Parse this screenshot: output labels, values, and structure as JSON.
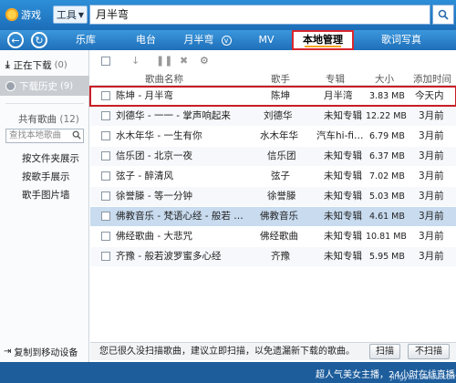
{
  "topbar": {
    "game_label": "游戏",
    "tools_label": "工具",
    "search_value": "月半弯"
  },
  "nav": {
    "tabs": [
      {
        "label": "乐库"
      },
      {
        "label": "电台"
      },
      {
        "label": "月半弯"
      },
      {
        "label": "MV"
      },
      {
        "label": "本地管理"
      },
      {
        "label": "歌词写真"
      }
    ]
  },
  "sidebar": {
    "downloading": {
      "label": "正在下载",
      "count": "(0)"
    },
    "history": {
      "label": "下载历史",
      "count": "(9)"
    },
    "shared": {
      "label": "共有歌曲",
      "count": "(12)"
    },
    "search_placeholder": "查找本地歌曲",
    "links": [
      "按文件夹展示",
      "按歌手展示",
      "歌手图片墙"
    ],
    "bottom_label": "复制到移动设备"
  },
  "list": {
    "headers": {
      "name": "歌曲名称",
      "artist": "歌手",
      "album": "专辑",
      "size": "大小",
      "added": "添加时间"
    },
    "rows": [
      {
        "name": "陈坤 - 月半弯",
        "artist": "陈坤",
        "album": "月半湾",
        "size": "3.83 MB",
        "added": "今天内"
      },
      {
        "name": "刘德华 - 一一 - 掌声响起来",
        "artist": "刘德华",
        "album": "未知专辑",
        "size": "12.22 MB",
        "added": "3月前"
      },
      {
        "name": "水木年华 - 一生有你",
        "artist": "水木年华",
        "album": "汽车hi-fi…",
        "size": "6.79 MB",
        "added": "3月前"
      },
      {
        "name": "信乐团 - 北京一夜",
        "artist": "信乐团",
        "album": "未知专辑",
        "size": "6.37 MB",
        "added": "3月前"
      },
      {
        "name": "弦子 - 醉清风",
        "artist": "弦子",
        "album": "未知专辑",
        "size": "7.02 MB",
        "added": "3月前"
      },
      {
        "name": "徐誉滕 - 等一分钟",
        "artist": "徐誉滕",
        "album": "未知专辑",
        "size": "5.03 MB",
        "added": "3月前"
      },
      {
        "name": "佛教音乐 - 梵语心经 - 般若 …",
        "artist": "佛教音乐",
        "album": "未知专辑",
        "size": "4.61 MB",
        "added": "3月前"
      },
      {
        "name": "佛经歌曲 - 大悲咒",
        "artist": "佛经歌曲",
        "album": "未知专辑",
        "size": "10.81 MB",
        "added": "3月前"
      },
      {
        "name": "齐豫 - 般若波罗蜜多心经",
        "artist": "齐豫",
        "album": "未知专辑",
        "size": "5.95 MB",
        "added": "3月前"
      }
    ]
  },
  "statusbar": {
    "message": "您已很久没扫描歌曲，建议立即扫描，以免遗漏新下载的歌曲。",
    "scan_label": "扫描",
    "stop_label": "不扫描"
  },
  "footer": {
    "text": "超人气美女主播，24小时在线直播",
    "watermark": "jingyan.baidu.com"
  },
  "colors": {
    "brand": "#1c6db8",
    "highlight_border": "#d8272e",
    "playing_row": "#c8dbef"
  }
}
